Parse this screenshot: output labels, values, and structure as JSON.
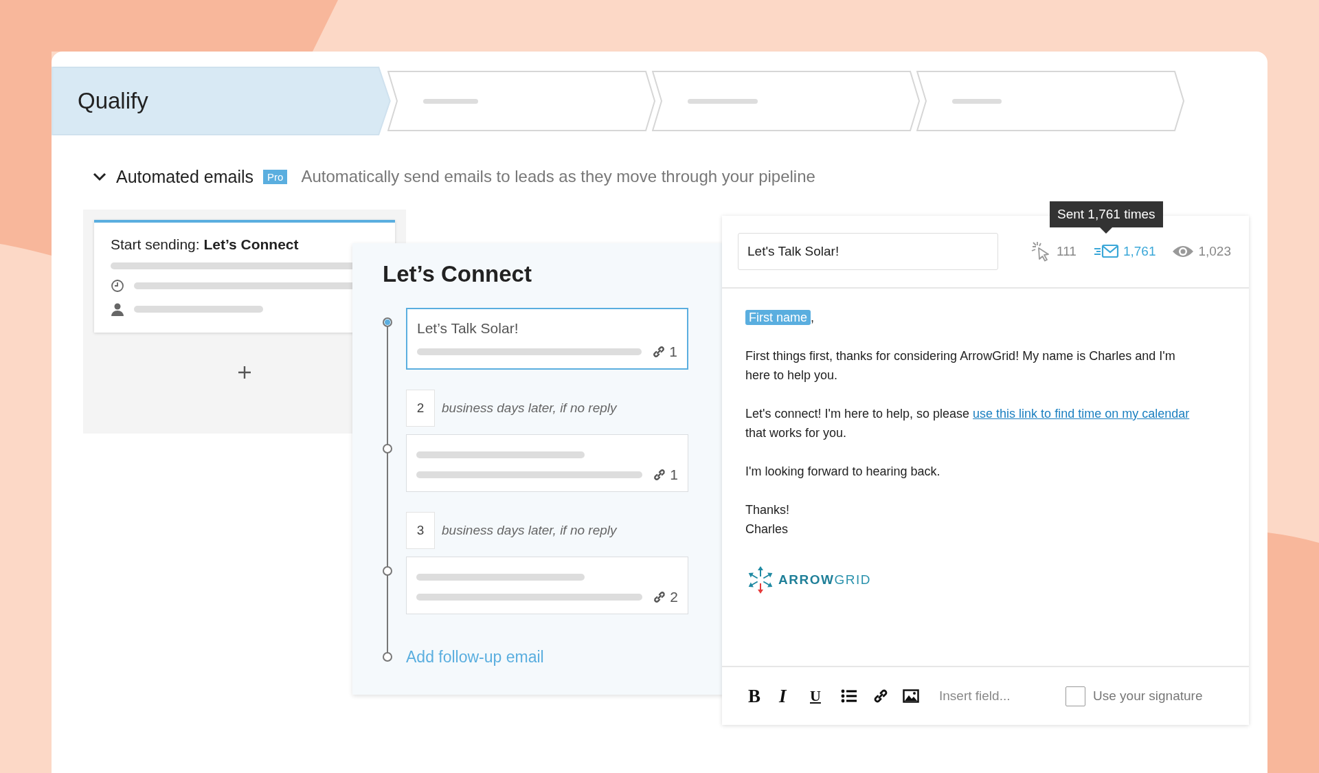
{
  "stages": [
    {
      "label": "Qualify",
      "selected": true
    },
    {
      "selected": false
    },
    {
      "selected": false
    },
    {
      "selected": false
    }
  ],
  "section": {
    "title": "Automated emails",
    "expanded": true,
    "badge": "Pro",
    "description": "Automatically send emails to leads as they move through your pipeline"
  },
  "trigger_card": {
    "label": "Start sending: **Let’s Connect**"
  },
  "sequence": {
    "title": "Let’s Connect",
    "steps": [
      {
        "kind": "email",
        "subject": "Let’s Talk Solar!",
        "links": "1",
        "selected": true
      },
      {
        "kind": "delay",
        "days": "2",
        "text": "business days later, if no reply"
      },
      {
        "kind": "email",
        "links": "1",
        "selected": false
      },
      {
        "kind": "delay",
        "days": "3",
        "text": "business days later, if no reply"
      },
      {
        "kind": "email",
        "links": "2",
        "selected": false
      }
    ],
    "add_label": "Add follow-up email"
  },
  "editor": {
    "subject": "Let's Talk Solar!",
    "stats": [
      {
        "kind": "clicks",
        "value": "111",
        "selected": false
      },
      {
        "kind": "sent",
        "value": "1,761",
        "selected": true
      },
      {
        "kind": "opens",
        "value": "1,023",
        "selected": false
      }
    ],
    "tooltip": "Sent 1,761 times",
    "body": [
      {
        "kind": "greeting",
        "field": "First name",
        "after": ","
      },
      {
        "kind": "text",
        "text": "First things first, thanks for considering ArrowGrid! My name is Charles and I'm here to help you."
      },
      {
        "kind": "link_text",
        "before": "Let's connect! I'm here to help, so please ",
        "link": "use this link to find time on my calendar",
        "after": " that works for you."
      },
      {
        "kind": "text",
        "text": "I'm looking forward to hearing back."
      },
      {
        "kind": "lines",
        "lines": [
          "Thanks!",
          "Charles"
        ]
      }
    ],
    "logo_text": "**ARROW**GRID",
    "tools": [
      {
        "kind": "bold",
        "glyph": "B"
      },
      {
        "kind": "italic",
        "glyph": "I"
      },
      {
        "kind": "underline",
        "glyph": "U"
      },
      {
        "kind": "list"
      },
      {
        "kind": "link"
      },
      {
        "kind": "image"
      }
    ],
    "insert_field_placeholder": "Insert field...",
    "signature": {
      "label": "Use your signature",
      "checked": false
    }
  }
}
